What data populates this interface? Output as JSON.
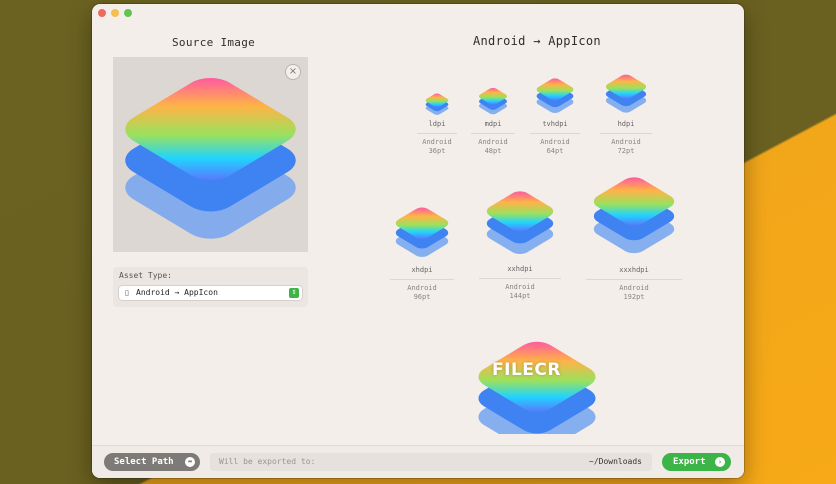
{
  "window": {
    "source_title": "Source Image",
    "output_title": "Android → AppIcon"
  },
  "preview": {
    "clear_glyph": "×"
  },
  "asset": {
    "label": "Asset Type:",
    "value": "Android → AppIcon",
    "icon": "phone-icon",
    "stepper_glyph": "⇕"
  },
  "icons": [
    {
      "density": "ldpi",
      "platform": "Android",
      "size": "36pt"
    },
    {
      "density": "mdpi",
      "platform": "Android",
      "size": "48pt"
    },
    {
      "density": "tvhdpi",
      "platform": "Android",
      "size": "64pt"
    },
    {
      "density": "hdpi",
      "platform": "Android",
      "size": "72pt"
    },
    {
      "density": "xhdpi",
      "platform": "Android",
      "size": "96pt"
    },
    {
      "density": "xxhdpi",
      "platform": "Android",
      "size": "144pt"
    },
    {
      "density": "xxxhdpi",
      "platform": "Android",
      "size": "192pt"
    }
  ],
  "watermark": "FILECR",
  "bottom": {
    "select_path_label": "Select Path",
    "export_label": "Will be exported to:",
    "export_path": "~/Downloads",
    "export_button": "Export"
  },
  "colors": {
    "accent_green": "#3cb448",
    "layer_blue_dark": "#3f82f2",
    "layer_blue_light": "#7aa7f0"
  }
}
